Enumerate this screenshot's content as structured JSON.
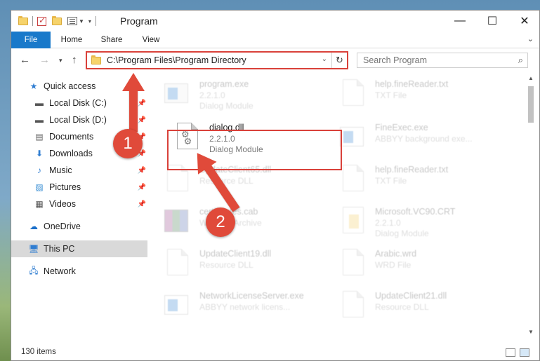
{
  "window": {
    "title": "Program"
  },
  "ribbon": {
    "tabs": [
      "File",
      "Home",
      "Share",
      "View"
    ]
  },
  "address": {
    "path": "C:\\Program Files\\Program Directory"
  },
  "search": {
    "placeholder": "Search Program"
  },
  "sidebar": {
    "items": [
      {
        "label": "Quick access",
        "icon": "star-icon"
      },
      {
        "label": "Local Disk (C:)",
        "icon": "drive-icon"
      },
      {
        "label": "Local Disk (D:)",
        "icon": "drive-icon"
      },
      {
        "label": "Documents",
        "icon": "documents-icon"
      },
      {
        "label": "Downloads",
        "icon": "download-icon"
      },
      {
        "label": "Music",
        "icon": "music-icon"
      },
      {
        "label": "Pictures",
        "icon": "pictures-icon"
      },
      {
        "label": "Videos",
        "icon": "videos-icon"
      },
      {
        "label": "OneDrive",
        "icon": "cloud-icon"
      },
      {
        "label": "This PC",
        "icon": "computer-icon"
      },
      {
        "label": "Network",
        "icon": "network-icon"
      }
    ]
  },
  "files": [
    {
      "name": "program.exe",
      "line2": "2.2.1.0",
      "line3": "Dialog Module"
    },
    {
      "name": "help.fineReader.txt",
      "line2": "TXT File",
      "line3": ""
    },
    {
      "name": "dialog.dll",
      "line2": "2.2.1.0",
      "line3": "Dialog Module"
    },
    {
      "name": "FineExec.exe",
      "line2": "ABBYY background exe...",
      "line3": ""
    },
    {
      "name": "UpdateClient65.dll",
      "line2": "Resource DLL",
      "line3": ""
    },
    {
      "name": "help.fineReader.txt",
      "line2": "TXT File",
      "line3": ""
    },
    {
      "name": "certificates.cab",
      "line2": "WinRAR Archive",
      "line3": ""
    },
    {
      "name": "Microsoft.VC90.CRT",
      "line2": "2.2.1.0",
      "line3": "Dialog Module"
    },
    {
      "name": "UpdateClient19.dll",
      "line2": "Resource DLL",
      "line3": ""
    },
    {
      "name": "Arabic.wrd",
      "line2": "WRD File",
      "line3": ""
    },
    {
      "name": "NetworkLicenseServer.exe",
      "line2": "ABBYY network licens...",
      "line3": ""
    },
    {
      "name": "UpdateClient21.dll",
      "line2": "Resource DLL",
      "line3": ""
    }
  ],
  "annotations": [
    "1",
    "2"
  ],
  "status": {
    "count": "130 items"
  },
  "colors": {
    "accent": "#1979ca",
    "highlight": "#d9413a",
    "badge": "#e04a3a"
  }
}
